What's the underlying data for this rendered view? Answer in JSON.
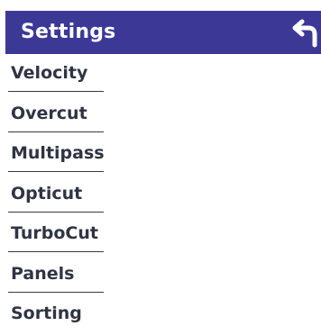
{
  "header": {
    "title": "Settings",
    "back_icon": "back-arrow-icon",
    "background_color": "#3c3896"
  },
  "menu": {
    "items": [
      {
        "label": "Velocity"
      },
      {
        "label": "Overcut"
      },
      {
        "label": "Multipass"
      },
      {
        "label": "Opticut"
      },
      {
        "label": "TurboCut"
      },
      {
        "label": "Panels"
      },
      {
        "label": "Sorting"
      }
    ]
  }
}
